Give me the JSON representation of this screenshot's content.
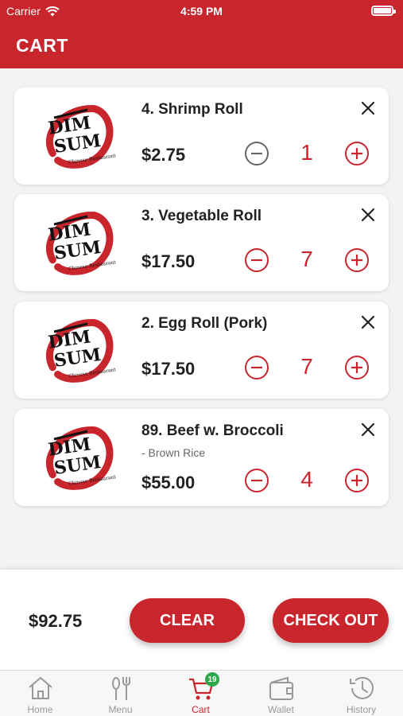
{
  "status_bar": {
    "carrier": "Carrier",
    "time": "4:59 PM"
  },
  "header": {
    "title": "CART"
  },
  "brand": {
    "accent": "#c9252c",
    "badge_color": "#2aa84a",
    "logo_text": "DIM SUM"
  },
  "cart": {
    "items": [
      {
        "name": "4. Shrimp Roll",
        "price": "$2.75",
        "quantity": "1"
      },
      {
        "name": "3. Vegetable Roll",
        "price": "$17.50",
        "quantity": "7"
      },
      {
        "name": "2. Egg Roll (Pork)",
        "price": "$17.50",
        "quantity": "7"
      },
      {
        "name": "89. Beef w. Broccoli",
        "option": "- Brown Rice",
        "price": "$55.00",
        "quantity": "4"
      }
    ],
    "total": "$92.75",
    "clear_label": "CLEAR",
    "checkout_label": "CHECK OUT"
  },
  "tabbar": {
    "tabs": [
      {
        "label": "Home",
        "icon": "home-icon"
      },
      {
        "label": "Menu",
        "icon": "fork-knife-icon"
      },
      {
        "label": "Cart",
        "icon": "cart-icon",
        "badge": "19",
        "active": true
      },
      {
        "label": "Wallet",
        "icon": "wallet-icon"
      },
      {
        "label": "History",
        "icon": "history-icon"
      }
    ]
  }
}
